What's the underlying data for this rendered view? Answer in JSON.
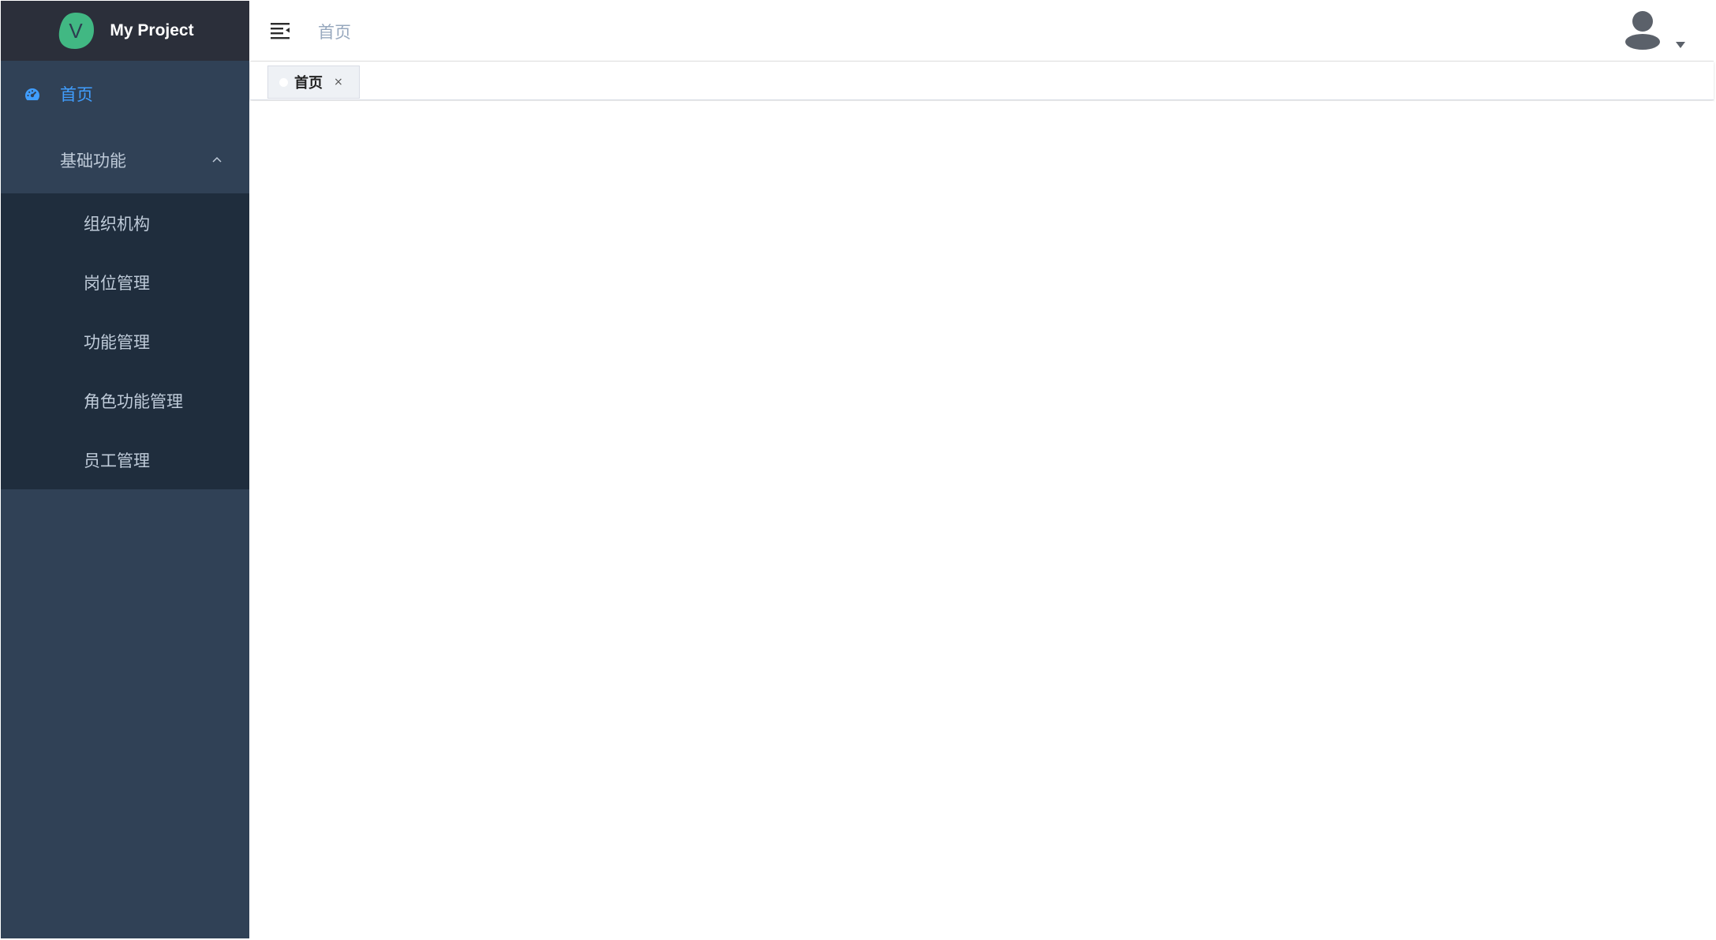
{
  "app": {
    "title": "My Project",
    "logo_letter": "V",
    "logo_color": "#41b883"
  },
  "sidebar": {
    "home": {
      "label": "首页",
      "icon": "dashboard-icon"
    },
    "group": {
      "label": "基础功能",
      "expanded": true,
      "items": [
        {
          "label": "组织机构"
        },
        {
          "label": "岗位管理"
        },
        {
          "label": "功能管理"
        },
        {
          "label": "角色功能管理"
        },
        {
          "label": "员工管理"
        }
      ]
    }
  },
  "header": {
    "breadcrumb": "首页",
    "hamburger_icon": "menu-fold-icon",
    "avatar_icon": "user-avatar-icon"
  },
  "tags": [
    {
      "label": "首页",
      "close": "×"
    }
  ],
  "colors": {
    "sidebar_bg": "#304156",
    "submenu_bg": "#1f2d3d",
    "logo_bar_bg": "#2b2f3a",
    "active_text": "#409eff",
    "menu_text": "#bfcbd9"
  }
}
